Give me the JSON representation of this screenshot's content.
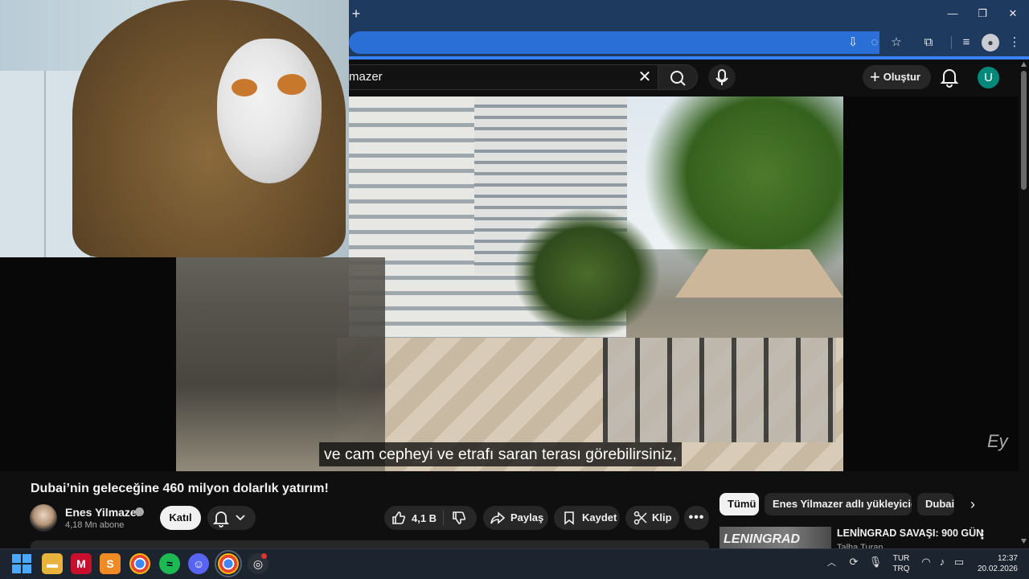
{
  "browser": {
    "new_tab": "+",
    "minimize": "—",
    "restore": "❐",
    "close": "✕",
    "colors": {
      "chrome": "#1f3a5f",
      "omnibox": "#2a6fd6",
      "accent": "#3b82f6"
    }
  },
  "masthead": {
    "search_value": "mazer",
    "create_label": "Oluştur",
    "user_initial": "U",
    "user_color": "#00897b"
  },
  "video": {
    "subtitle": "ve cam cepheyi ve etrafı saran terası görebilirsiniz,",
    "watermark": "Ey"
  },
  "info": {
    "title": "Dubai’nin geleceğine 460 milyon dolarlık yatırım!",
    "channel_name": "Enes Yilmazer",
    "subscribers": "4,18 Mn abone",
    "join_label": "Katıl",
    "like_count": "4,1 B",
    "share_label": "Paylaş",
    "save_label": "Kaydet",
    "clip_label": "Klip",
    "more_label": "•••"
  },
  "rail": {
    "chips": [
      "Tümü",
      "Enes Yilmazer adlı yükleyiciden",
      "Dubai"
    ],
    "next": "›",
    "rec_thumb_text": "LENINGRAD",
    "rec_title": "LENİNGRAD SAVAŞI: 900 GÜN",
    "rec_channel": "Talha Turan",
    "rec_more": "⋮"
  },
  "taskbar": {
    "apps": [
      "windows-start",
      "file-explorer",
      "mcafee",
      "sublime-text",
      "chrome",
      "spotify",
      "discord",
      "chrome-canary",
      "obs"
    ],
    "lang_line1": "TUR",
    "lang_line2": "TRQ",
    "time": "12:37",
    "date": "20.02.2026"
  }
}
